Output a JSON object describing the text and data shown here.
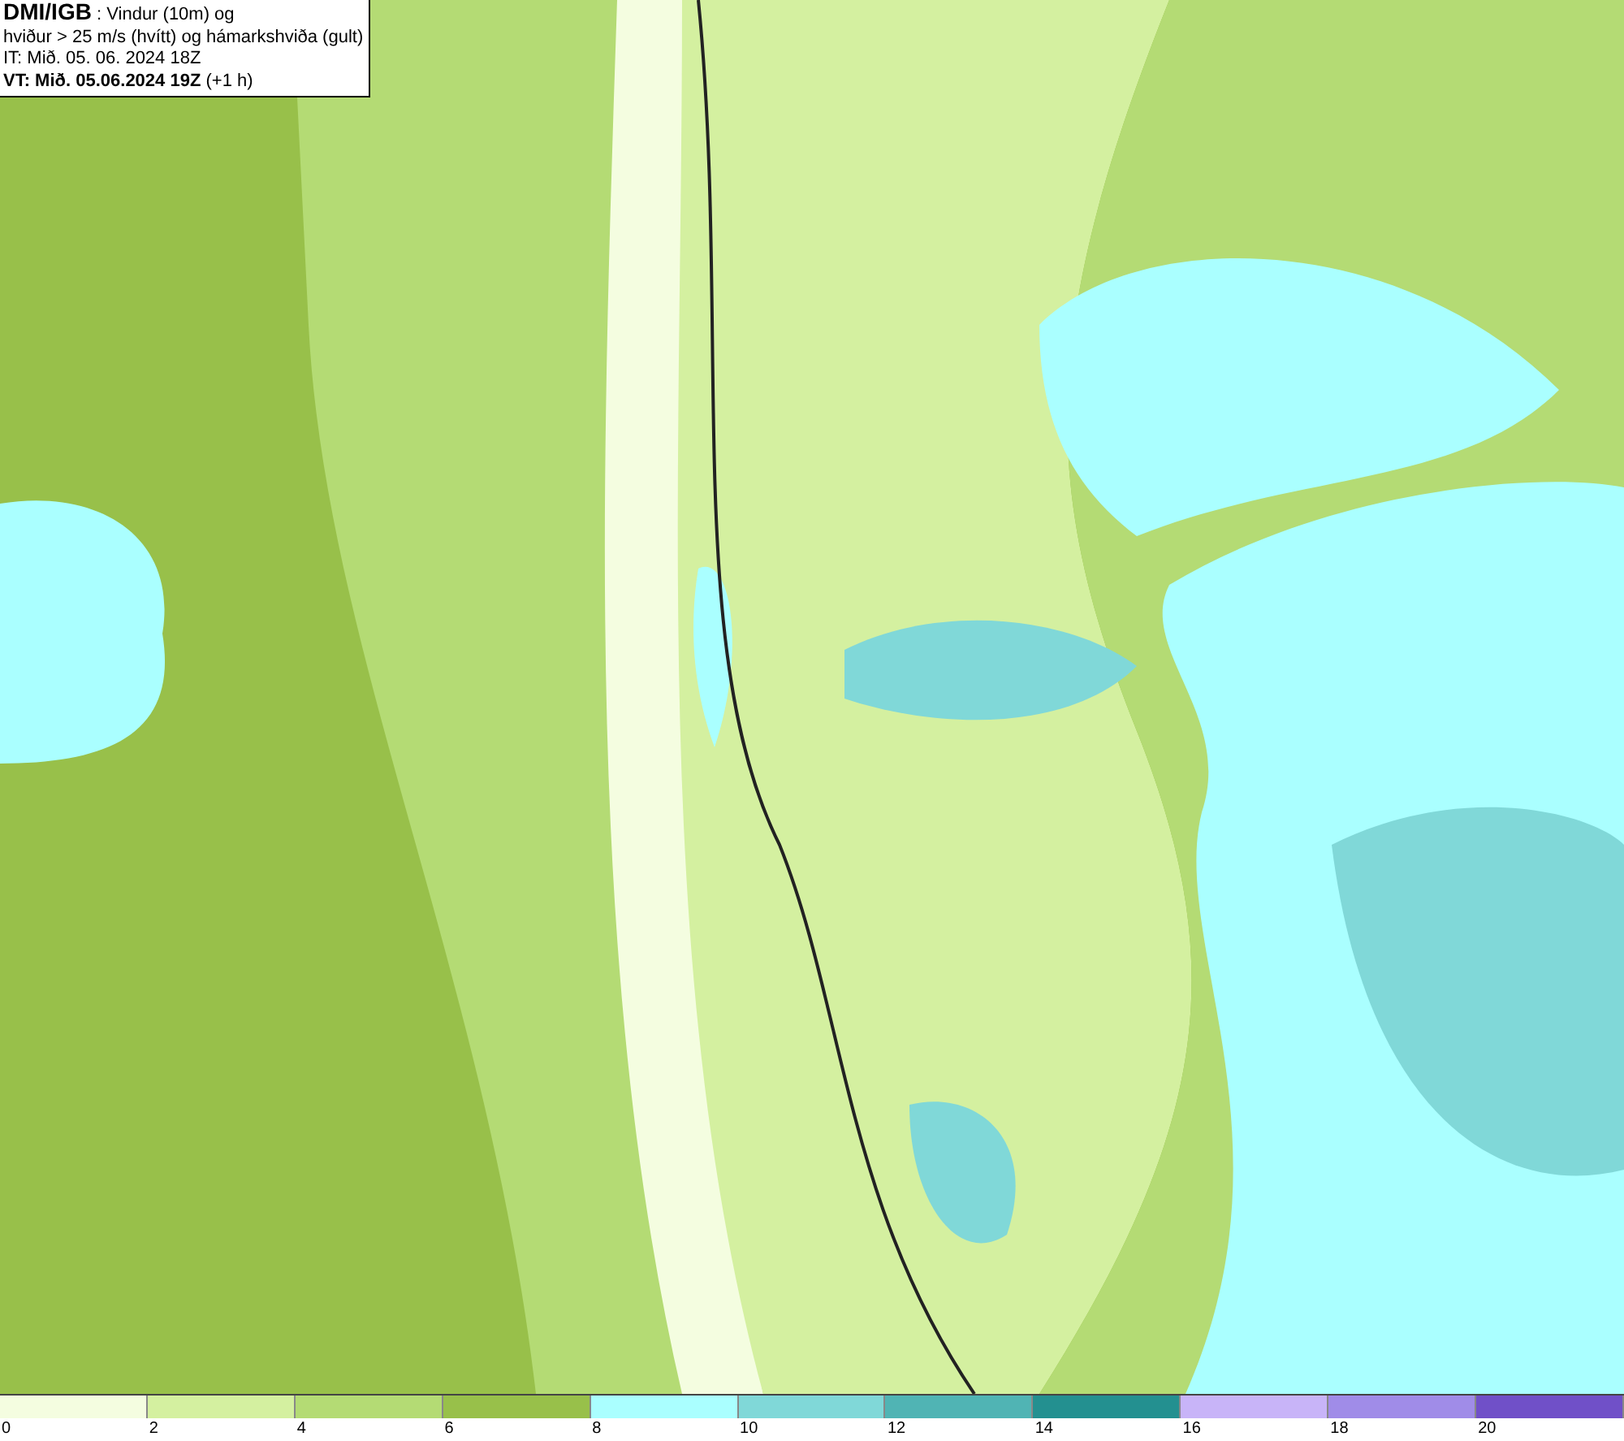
{
  "info_box": {
    "lines": [
      "**DMI/IGB** : Vindur (10m) og",
      "hviður > 25 m/s (hvítt) og hámarkshviða (gult)",
      "IT: Mið. 05. 06. 2024 18Z",
      "**VT: Mið. 05.06.2024 19Z** (+1 h)"
    ]
  },
  "legend": {
    "bins": [
      {
        "color": "#f4fde0",
        "label": "0"
      },
      {
        "color": "#d4f0a0",
        "label": "2"
      },
      {
        "color": "#b4db74",
        "label": "4"
      },
      {
        "color": "#98c04a",
        "label": "6"
      },
      {
        "color": "#aaffff",
        "label": "8"
      },
      {
        "color": "#80d8d8",
        "label": "10"
      },
      {
        "color": "#50b4b4",
        "label": "12"
      },
      {
        "color": "#239090",
        "label": "14"
      },
      {
        "color": "#c8b4f8",
        "label": "16"
      },
      {
        "color": "#a08ce8",
        "label": "18"
      },
      {
        "color": "#7050c8",
        "label": "20"
      }
    ]
  }
}
